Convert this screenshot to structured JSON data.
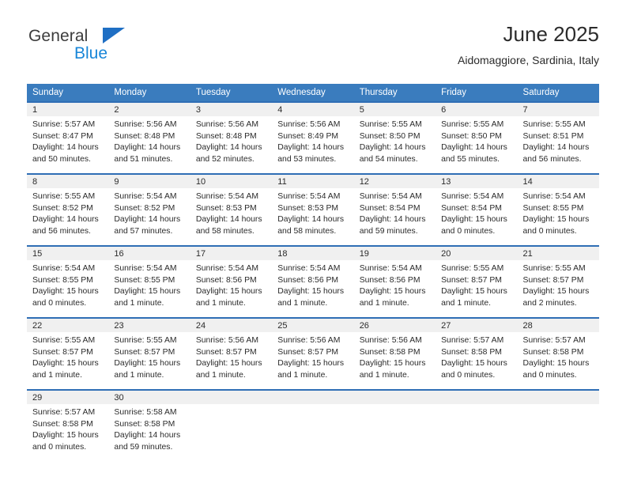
{
  "brand": {
    "name_part1": "General",
    "name_part2": "Blue",
    "triangle_color": "#1f6fc4",
    "blue_text_color": "#1886d8"
  },
  "header": {
    "title": "June 2025",
    "location": "Aidomaggiore, Sardinia, Italy"
  },
  "theme": {
    "header_row_background": "#3a7cbe",
    "header_row_text": "#ffffff",
    "row_border": "#2f6eb5",
    "daynumber_band": "#f0f0f0",
    "body_text": "#2b2b2b"
  },
  "weekday_headers": [
    "Sunday",
    "Monday",
    "Tuesday",
    "Wednesday",
    "Thursday",
    "Friday",
    "Saturday"
  ],
  "labels": {
    "sunrise_prefix": "Sunrise:",
    "sunset_prefix": "Sunset:",
    "daylight_prefix": "Daylight:"
  },
  "weeks": [
    [
      {
        "day": "1",
        "sunrise": "Sunrise: 5:57 AM",
        "sunset": "Sunset: 8:47 PM",
        "daylight_line1": "Daylight: 14 hours",
        "daylight_line2": "and 50 minutes."
      },
      {
        "day": "2",
        "sunrise": "Sunrise: 5:56 AM",
        "sunset": "Sunset: 8:48 PM",
        "daylight_line1": "Daylight: 14 hours",
        "daylight_line2": "and 51 minutes."
      },
      {
        "day": "3",
        "sunrise": "Sunrise: 5:56 AM",
        "sunset": "Sunset: 8:48 PM",
        "daylight_line1": "Daylight: 14 hours",
        "daylight_line2": "and 52 minutes."
      },
      {
        "day": "4",
        "sunrise": "Sunrise: 5:56 AM",
        "sunset": "Sunset: 8:49 PM",
        "daylight_line1": "Daylight: 14 hours",
        "daylight_line2": "and 53 minutes."
      },
      {
        "day": "5",
        "sunrise": "Sunrise: 5:55 AM",
        "sunset": "Sunset: 8:50 PM",
        "daylight_line1": "Daylight: 14 hours",
        "daylight_line2": "and 54 minutes."
      },
      {
        "day": "6",
        "sunrise": "Sunrise: 5:55 AM",
        "sunset": "Sunset: 8:50 PM",
        "daylight_line1": "Daylight: 14 hours",
        "daylight_line2": "and 55 minutes."
      },
      {
        "day": "7",
        "sunrise": "Sunrise: 5:55 AM",
        "sunset": "Sunset: 8:51 PM",
        "daylight_line1": "Daylight: 14 hours",
        "daylight_line2": "and 56 minutes."
      }
    ],
    [
      {
        "day": "8",
        "sunrise": "Sunrise: 5:55 AM",
        "sunset": "Sunset: 8:52 PM",
        "daylight_line1": "Daylight: 14 hours",
        "daylight_line2": "and 56 minutes."
      },
      {
        "day": "9",
        "sunrise": "Sunrise: 5:54 AM",
        "sunset": "Sunset: 8:52 PM",
        "daylight_line1": "Daylight: 14 hours",
        "daylight_line2": "and 57 minutes."
      },
      {
        "day": "10",
        "sunrise": "Sunrise: 5:54 AM",
        "sunset": "Sunset: 8:53 PM",
        "daylight_line1": "Daylight: 14 hours",
        "daylight_line2": "and 58 minutes."
      },
      {
        "day": "11",
        "sunrise": "Sunrise: 5:54 AM",
        "sunset": "Sunset: 8:53 PM",
        "daylight_line1": "Daylight: 14 hours",
        "daylight_line2": "and 58 minutes."
      },
      {
        "day": "12",
        "sunrise": "Sunrise: 5:54 AM",
        "sunset": "Sunset: 8:54 PM",
        "daylight_line1": "Daylight: 14 hours",
        "daylight_line2": "and 59 minutes."
      },
      {
        "day": "13",
        "sunrise": "Sunrise: 5:54 AM",
        "sunset": "Sunset: 8:54 PM",
        "daylight_line1": "Daylight: 15 hours",
        "daylight_line2": "and 0 minutes."
      },
      {
        "day": "14",
        "sunrise": "Sunrise: 5:54 AM",
        "sunset": "Sunset: 8:55 PM",
        "daylight_line1": "Daylight: 15 hours",
        "daylight_line2": "and 0 minutes."
      }
    ],
    [
      {
        "day": "15",
        "sunrise": "Sunrise: 5:54 AM",
        "sunset": "Sunset: 8:55 PM",
        "daylight_line1": "Daylight: 15 hours",
        "daylight_line2": "and 0 minutes."
      },
      {
        "day": "16",
        "sunrise": "Sunrise: 5:54 AM",
        "sunset": "Sunset: 8:55 PM",
        "daylight_line1": "Daylight: 15 hours",
        "daylight_line2": "and 1 minute."
      },
      {
        "day": "17",
        "sunrise": "Sunrise: 5:54 AM",
        "sunset": "Sunset: 8:56 PM",
        "daylight_line1": "Daylight: 15 hours",
        "daylight_line2": "and 1 minute."
      },
      {
        "day": "18",
        "sunrise": "Sunrise: 5:54 AM",
        "sunset": "Sunset: 8:56 PM",
        "daylight_line1": "Daylight: 15 hours",
        "daylight_line2": "and 1 minute."
      },
      {
        "day": "19",
        "sunrise": "Sunrise: 5:54 AM",
        "sunset": "Sunset: 8:56 PM",
        "daylight_line1": "Daylight: 15 hours",
        "daylight_line2": "and 1 minute."
      },
      {
        "day": "20",
        "sunrise": "Sunrise: 5:55 AM",
        "sunset": "Sunset: 8:57 PM",
        "daylight_line1": "Daylight: 15 hours",
        "daylight_line2": "and 1 minute."
      },
      {
        "day": "21",
        "sunrise": "Sunrise: 5:55 AM",
        "sunset": "Sunset: 8:57 PM",
        "daylight_line1": "Daylight: 15 hours",
        "daylight_line2": "and 2 minutes."
      }
    ],
    [
      {
        "day": "22",
        "sunrise": "Sunrise: 5:55 AM",
        "sunset": "Sunset: 8:57 PM",
        "daylight_line1": "Daylight: 15 hours",
        "daylight_line2": "and 1 minute."
      },
      {
        "day": "23",
        "sunrise": "Sunrise: 5:55 AM",
        "sunset": "Sunset: 8:57 PM",
        "daylight_line1": "Daylight: 15 hours",
        "daylight_line2": "and 1 minute."
      },
      {
        "day": "24",
        "sunrise": "Sunrise: 5:56 AM",
        "sunset": "Sunset: 8:57 PM",
        "daylight_line1": "Daylight: 15 hours",
        "daylight_line2": "and 1 minute."
      },
      {
        "day": "25",
        "sunrise": "Sunrise: 5:56 AM",
        "sunset": "Sunset: 8:57 PM",
        "daylight_line1": "Daylight: 15 hours",
        "daylight_line2": "and 1 minute."
      },
      {
        "day": "26",
        "sunrise": "Sunrise: 5:56 AM",
        "sunset": "Sunset: 8:58 PM",
        "daylight_line1": "Daylight: 15 hours",
        "daylight_line2": "and 1 minute."
      },
      {
        "day": "27",
        "sunrise": "Sunrise: 5:57 AM",
        "sunset": "Sunset: 8:58 PM",
        "daylight_line1": "Daylight: 15 hours",
        "daylight_line2": "and 0 minutes."
      },
      {
        "day": "28",
        "sunrise": "Sunrise: 5:57 AM",
        "sunset": "Sunset: 8:58 PM",
        "daylight_line1": "Daylight: 15 hours",
        "daylight_line2": "and 0 minutes."
      }
    ],
    [
      {
        "day": "29",
        "sunrise": "Sunrise: 5:57 AM",
        "sunset": "Sunset: 8:58 PM",
        "daylight_line1": "Daylight: 15 hours",
        "daylight_line2": "and 0 minutes."
      },
      {
        "day": "30",
        "sunrise": "Sunrise: 5:58 AM",
        "sunset": "Sunset: 8:58 PM",
        "daylight_line1": "Daylight: 14 hours",
        "daylight_line2": "and 59 minutes."
      },
      {
        "day": "",
        "sunrise": "",
        "sunset": "",
        "daylight_line1": "",
        "daylight_line2": ""
      },
      {
        "day": "",
        "sunrise": "",
        "sunset": "",
        "daylight_line1": "",
        "daylight_line2": ""
      },
      {
        "day": "",
        "sunrise": "",
        "sunset": "",
        "daylight_line1": "",
        "daylight_line2": ""
      },
      {
        "day": "",
        "sunrise": "",
        "sunset": "",
        "daylight_line1": "",
        "daylight_line2": ""
      },
      {
        "day": "",
        "sunrise": "",
        "sunset": "",
        "daylight_line1": "",
        "daylight_line2": ""
      }
    ]
  ]
}
